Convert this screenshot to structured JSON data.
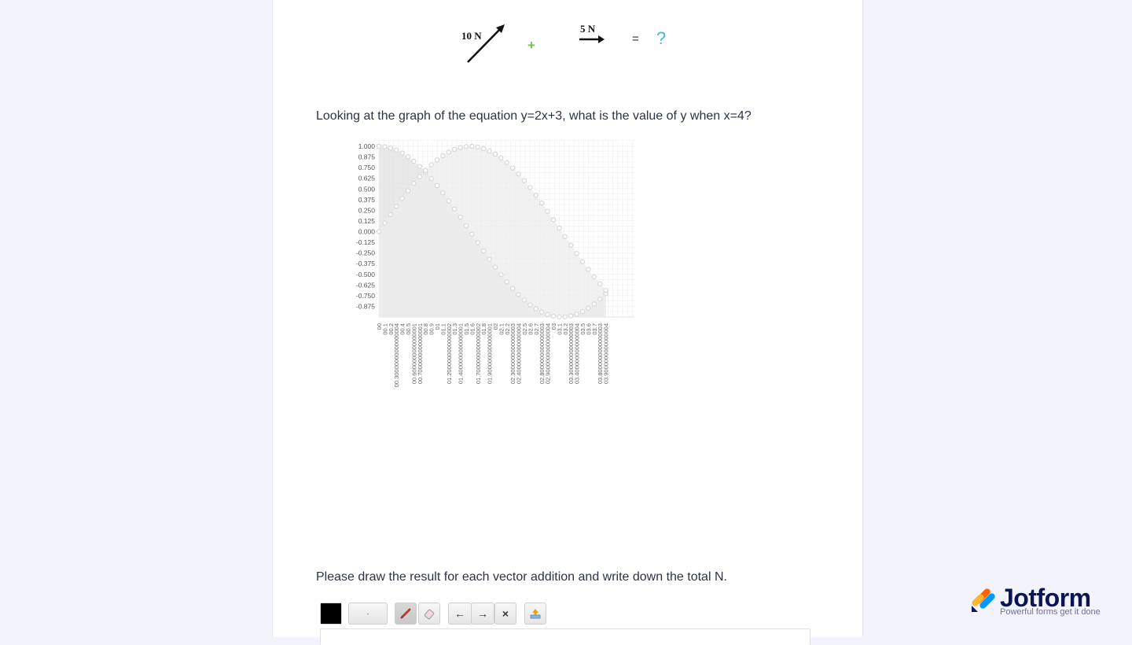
{
  "vectors": {
    "first_label": "10 N",
    "plus_symbol": "+",
    "second_label": "5 N",
    "equals_symbol": "=",
    "result_symbol": "?"
  },
  "question1": {
    "text": "Looking at the graph of the equation y=2x+3, what is the value of y when x=4?"
  },
  "question2": {
    "text": "Please draw the result for each vector addition and write down the total N."
  },
  "toolbar": {
    "color_swatch": "#000000",
    "size_label": "·",
    "undo_label": "←",
    "redo_label": "→",
    "clear_label": "×",
    "tools": [
      "pencil-icon",
      "eraser-icon",
      "save-icon"
    ]
  },
  "branding": {
    "name": "Jotform",
    "tagline": "Powerful forms get it done"
  },
  "colors": {
    "page_bg": "#f3f3fe",
    "brand_navy": "#0a1551",
    "result_blue": "#3fb6ec",
    "plus_green": "#7cc242"
  },
  "chart_data": {
    "type": "area",
    "ylim": [
      -0.875,
      1.0
    ],
    "y_ticks": [
      "1.000",
      "0.875",
      "0.750",
      "0.625",
      "0.500",
      "0.375",
      "0.250",
      "0.125",
      "0.000",
      "-0.125",
      "-0.250",
      "-0.375",
      "-0.500",
      "-0.625",
      "-0.750",
      "-0.875"
    ],
    "x": [
      0,
      0.1,
      0.2,
      0.3,
      0.4,
      0.5,
      0.6,
      0.7,
      0.8,
      0.9,
      1.0,
      1.1,
      1.2,
      1.3,
      1.4,
      1.5,
      1.6,
      1.7,
      1.8,
      1.9,
      2.0,
      2.1,
      2.2,
      2.3,
      2.4,
      2.5,
      2.6,
      2.7,
      2.8,
      2.9,
      3.0,
      3.1,
      3.2,
      3.3,
      3.4,
      3.5,
      3.6,
      3.7,
      3.8,
      3.9
    ],
    "x_tick_labels": [
      "00",
      "00.1",
      "00.2",
      "00.30000000000000004",
      "00.4",
      "00.5",
      "00.6000000000000001",
      "00.7000000000000001",
      "00.8",
      "00.9",
      "01",
      "01.1",
      "01.2000000000000002",
      "01.3",
      "01.4000000000000001",
      "01.5",
      "01.6",
      "01.7000000000000002",
      "01.8",
      "01.9000000000000001",
      "02",
      "02.1",
      "02.2",
      "02.3000000000000003",
      "02.4000000000000004",
      "02.5",
      "02.6",
      "02.7",
      "02.8000000000000003",
      "02.9000000000000004",
      "03",
      "03.1",
      "03.2",
      "03.3000000000000003",
      "03.4000000000000004",
      "03.5",
      "03.6",
      "03.7",
      "03.8000000000000003",
      "03.9000000000000004"
    ],
    "series": [
      {
        "values": [
          1.0,
          0.995,
          0.98,
          0.955,
          0.921,
          0.878,
          0.825,
          0.765,
          0.697,
          0.622,
          0.54,
          0.454,
          0.362,
          0.267,
          0.17,
          0.071,
          -0.029,
          -0.129,
          -0.227,
          -0.323,
          -0.416,
          -0.505,
          -0.589,
          -0.666,
          -0.737,
          -0.801,
          -0.857,
          -0.904,
          -0.942,
          -0.971,
          -0.99,
          -0.999,
          -0.998,
          -0.987,
          -0.967,
          -0.936,
          -0.897,
          -0.848,
          -0.791,
          -0.726
        ]
      },
      {
        "values": [
          0.0,
          0.1,
          0.199,
          0.296,
          0.389,
          0.479,
          0.565,
          0.644,
          0.717,
          0.783,
          0.841,
          0.891,
          0.932,
          0.964,
          0.985,
          0.997,
          1.0,
          0.992,
          0.974,
          0.946,
          0.909,
          0.863,
          0.808,
          0.746,
          0.675,
          0.598,
          0.516,
          0.427,
          0.335,
          0.239,
          0.141,
          0.042,
          -0.058,
          -0.158,
          -0.256,
          -0.351,
          -0.443,
          -0.53,
          -0.612,
          -0.688
        ]
      }
    ],
    "grid": true
  }
}
